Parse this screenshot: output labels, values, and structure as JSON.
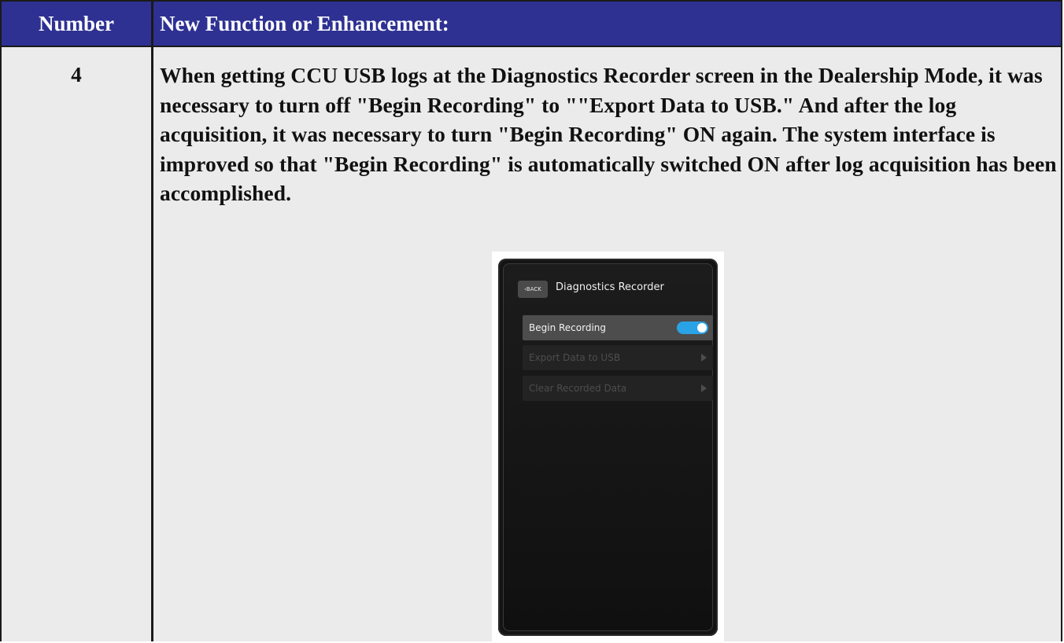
{
  "table": {
    "header": {
      "number_label": "Number",
      "function_label": "New Function or Enhancement:"
    },
    "row": {
      "number": "4",
      "description": "When getting CCU USB logs at the Diagnostics Recorder screen in the Dealership Mode, it was necessary to turn off \"Begin Recording\" to \"\"Export Data to USB.\" And after the log acquisition, it was necessary to turn \"Begin Recording\" ON again. The system interface is improved so that \"Begin Recording\" is automatically switched ON after log acquisition has been accomplished."
    }
  },
  "screenshot": {
    "back_label": "BACK",
    "title": "Diagnostics Recorder",
    "items": [
      {
        "label": "Begin Recording",
        "control": "toggle",
        "state": "on",
        "enabled": true
      },
      {
        "label": "Export Data to USB",
        "control": "arrow",
        "enabled": false
      },
      {
        "label": "Clear Recorded Data",
        "control": "arrow",
        "enabled": false
      }
    ]
  },
  "colors": {
    "header_bg": "#2e3192",
    "body_bg": "#ebebeb",
    "toggle_on": "#2aa3e6"
  }
}
